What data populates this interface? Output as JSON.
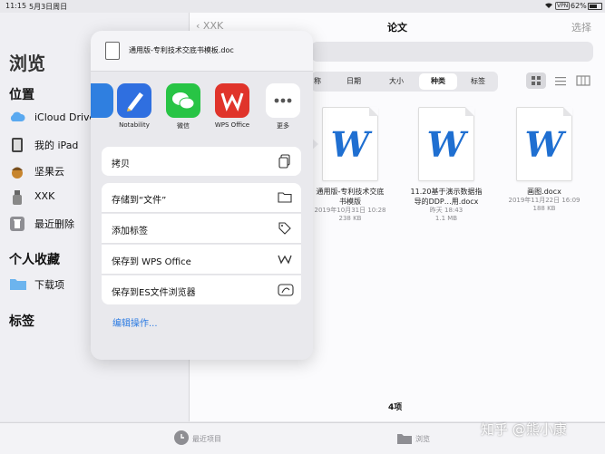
{
  "status": {
    "time": "11:15",
    "date": "5月3日周日",
    "vpn": "VPN",
    "battery": "62%"
  },
  "sidebar": {
    "title": "浏览",
    "locations_header": "位置",
    "locations": [
      {
        "label": "iCloud Drive",
        "icon": "cloud-icon"
      },
      {
        "label": "我的 iPad",
        "icon": "ipad-icon"
      },
      {
        "label": "坚果云",
        "icon": "nut-icon"
      },
      {
        "label": "XXK",
        "icon": "usb-icon"
      },
      {
        "label": "最近删除",
        "icon": "trash-icon"
      }
    ],
    "favorites_header": "个人收藏",
    "favorites": [
      {
        "label": "下载项",
        "icon": "folder-icon"
      }
    ],
    "tags_header": "标签"
  },
  "main": {
    "back_label": "XXK",
    "title": "论文",
    "select_label": "选择",
    "sort_tabs": [
      "称",
      "日期",
      "大小",
      "种类",
      "标签"
    ],
    "active_sort": "种类",
    "files": [
      {
        "name_line1": "通用版-专利技术交底",
        "name_line2": "书模版",
        "date": "2019年10月31日 10:28",
        "size": "238 KB",
        "icon_letter": "W"
      },
      {
        "name_line1": "11.20基于演示数据指",
        "name_line2": "导的DDP…用.docx",
        "date": "昨天 18:43",
        "size": "1.1 MB",
        "icon_letter": "W"
      },
      {
        "name_line1": "画图.docx",
        "name_line2": "",
        "date": "2019年11月22日 16:09",
        "size": "188 KB",
        "icon_letter": "W"
      }
    ],
    "item_count": "4项"
  },
  "share": {
    "filename": "通用版-专利技术交底书模板.doc",
    "apps": [
      {
        "label": "Notability",
        "color": "#2f6fe0"
      },
      {
        "label": "微信",
        "color": "#28c445"
      },
      {
        "label": "WPS Office",
        "color": "#e0342b"
      },
      {
        "label": "更多",
        "color": "#ffffff"
      }
    ],
    "actions": [
      {
        "label": "拷贝",
        "icon": "copy-icon"
      },
      {
        "label": "存储到“文件”",
        "icon": "folder-icon"
      },
      {
        "label": "添加标签",
        "icon": "tag-icon"
      },
      {
        "label": "保存到 WPS Office",
        "icon": "wps-icon"
      },
      {
        "label": "保存到ES文件浏览器",
        "icon": "es-explorer-icon"
      }
    ],
    "edit_actions": "编辑操作..."
  },
  "bottom": {
    "recent": "最近项目",
    "browse": "浏览"
  },
  "watermark": "知乎 @熊小康",
  "colors": {
    "accent": "#1f6fd1",
    "link": "#2a7ae2"
  }
}
